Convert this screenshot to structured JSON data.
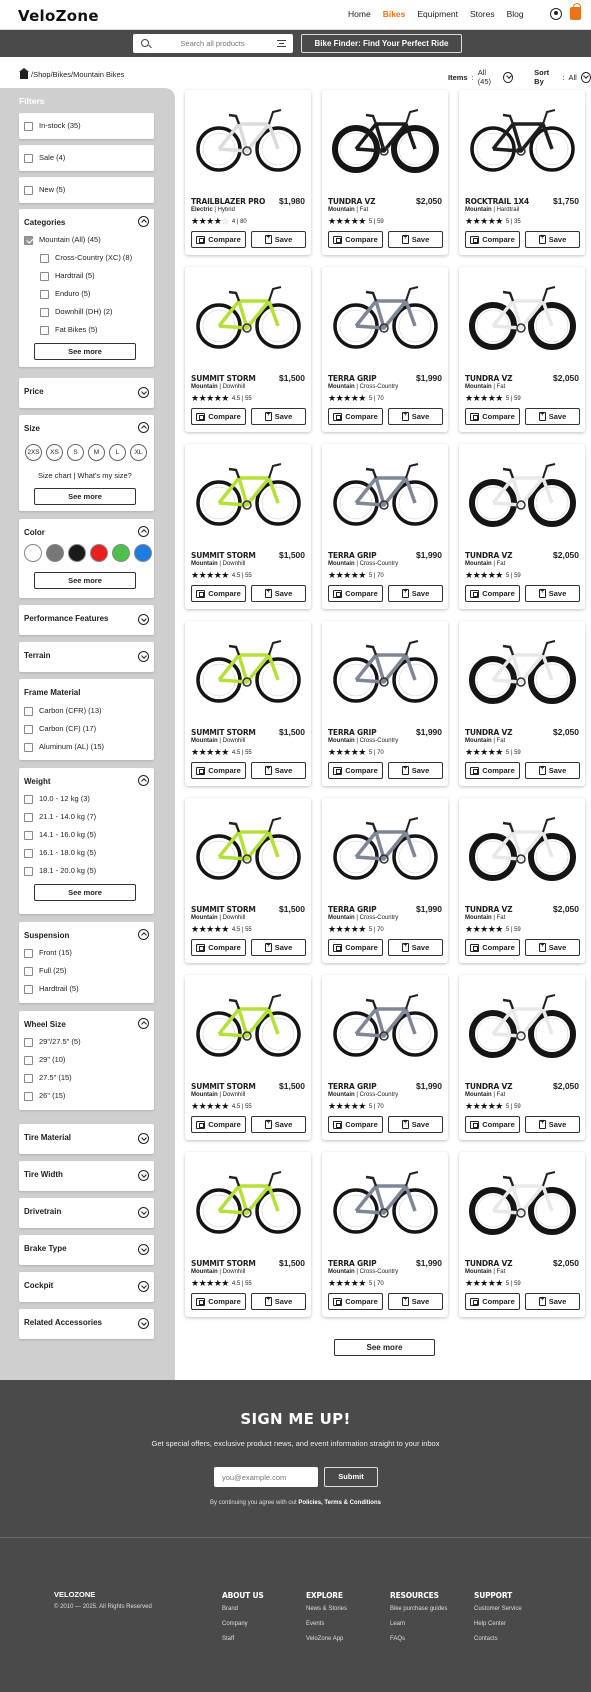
{
  "header": {
    "logo": "VeloZone",
    "nav": [
      "Home",
      "Bikes",
      "Equipment",
      "Stores",
      "Blog"
    ],
    "active_nav": "Bikes"
  },
  "search": {
    "placeholder": "Search all products",
    "finder_label": "Bike Finder: Find Your Perfect Ride"
  },
  "breadcrumb": "/Shop/Bikes/Mountain Bikes",
  "items_label": "Items",
  "items_value": "All (45)",
  "sort_label": "Sort By",
  "sort_value": "All",
  "filters": {
    "title": "Filters",
    "quick": [
      "In-stock (35)",
      "Sale (4)",
      "New (5)"
    ],
    "categories": {
      "title": "Categories",
      "parent": "Mountain (All) (45)",
      "items": [
        "Cross-Country (XC) (8)",
        "Hardtrail (5)",
        "Enduro (5)",
        "Downhill (DH) (2)",
        "Fat Bikes (5)"
      ],
      "see_more": "See more"
    },
    "price": "Price",
    "size": {
      "title": "Size",
      "options": [
        "2XS",
        "XS",
        "S",
        "M",
        "L",
        "XL"
      ],
      "chart": "Size chart",
      "what": "What's my size?",
      "see_more": "See more"
    },
    "color": {
      "title": "Color",
      "swatches": [
        "#ffffff",
        "#777777",
        "#1a1a1a",
        "#e82020",
        "#4cc24c",
        "#1e7be0"
      ],
      "see_more": "See more"
    },
    "performance": "Performance Features",
    "terrain": "Terrain",
    "frame": {
      "title": "Frame Material",
      "items": [
        "Carbon (CFR) (13)",
        "Carbon (CF) (17)",
        "Aluminum (AL) (15)"
      ]
    },
    "weight": {
      "title": "Weight",
      "items": [
        "10.0 - 12 kg  (3)",
        "21.1 - 14.0 kg (7)",
        "14.1 - 16.0 kg (5)",
        "16.1 - 18.0 kg (5)",
        "18.1 - 20.0 kg (5)"
      ],
      "see_more": "See more"
    },
    "suspension": {
      "title": "Suspension",
      "items": [
        "Front (15)",
        "Full (25)",
        "Hardtrail (5)"
      ]
    },
    "wheel": {
      "title": "Wheel Size",
      "items": [
        "29\"/27.5\" (5)",
        "29\" (10)",
        "27.5\" (15)",
        "26\" (15)"
      ]
    },
    "tire": "Tire Material",
    "tire_width": "Tire Width",
    "drivetrain": "Drivetrain",
    "brake": "Brake Type",
    "cockpit": "Cockpit",
    "accessories": "Related Accessories"
  },
  "products": [
    {
      "name": "TRAILBLAZER PRO",
      "price": "$1,980",
      "type": "Electric",
      "sub": "Hybrid",
      "rating": "4",
      "count": "80",
      "stars": 4,
      "img": "white-e"
    },
    {
      "name": "TUNDRA VZ",
      "price": "$2,050",
      "type": "Mountain",
      "sub": "Fat",
      "rating": "5",
      "count": "59",
      "stars": 5,
      "img": "black-fat"
    },
    {
      "name": "ROCKTRAIL 1X4",
      "price": "$1,750",
      "type": "Mountain",
      "sub": "Hardtrail",
      "rating": "5",
      "count": "35",
      "stars": 5,
      "img": "black"
    },
    {
      "name": "SUMMIT STORM",
      "price": "$1,500",
      "type": "Mountain",
      "sub": "Downhill",
      "rating": "4.5",
      "count": "55",
      "stars": 4.5,
      "img": "lime"
    },
    {
      "name": "TERRA GRIP",
      "price": "$1,990",
      "type": "Mountain",
      "sub": "Cross-Country",
      "rating": "5",
      "count": "70",
      "stars": 5,
      "img": "grey"
    },
    {
      "name": "TUNDRA VZ",
      "price": "$2,050",
      "type": "Mountain",
      "sub": "Fat",
      "rating": "5",
      "count": "59",
      "stars": 5,
      "img": "white-fat"
    },
    {
      "name": "SUMMIT STORM",
      "price": "$1,500",
      "type": "Mountain",
      "sub": "Downhill",
      "rating": "4.5",
      "count": "55",
      "stars": 4.5,
      "img": "lime"
    },
    {
      "name": "TERRA GRIP",
      "price": "$1,990",
      "type": "Mountain",
      "sub": "Cross-Country",
      "rating": "5",
      "count": "70",
      "stars": 5,
      "img": "grey"
    },
    {
      "name": "TUNDRA VZ",
      "price": "$2,050",
      "type": "Mountain",
      "sub": "Fat",
      "rating": "5",
      "count": "59",
      "stars": 5,
      "img": "white-fat"
    },
    {
      "name": "SUMMIT STORM",
      "price": "$1,500",
      "type": "Mountain",
      "sub": "Downhill",
      "rating": "4.5",
      "count": "55",
      "stars": 4.5,
      "img": "lime"
    },
    {
      "name": "TERRA GRIP",
      "price": "$1,990",
      "type": "Mountain",
      "sub": "Cross-Country",
      "rating": "5",
      "count": "70",
      "stars": 5,
      "img": "grey"
    },
    {
      "name": "TUNDRA VZ",
      "price": "$2,050",
      "type": "Mountain",
      "sub": "Fat",
      "rating": "5",
      "count": "59",
      "stars": 5,
      "img": "white-fat"
    },
    {
      "name": "SUMMIT STORM",
      "price": "$1,500",
      "type": "Mountain",
      "sub": "Downhill",
      "rating": "4.5",
      "count": "55",
      "stars": 4.5,
      "img": "lime"
    },
    {
      "name": "TERRA GRIP",
      "price": "$1,990",
      "type": "Mountain",
      "sub": "Cross-Country",
      "rating": "5",
      "count": "70",
      "stars": 5,
      "img": "grey"
    },
    {
      "name": "TUNDRA VZ",
      "price": "$2,050",
      "type": "Mountain",
      "sub": "Fat",
      "rating": "5",
      "count": "59",
      "stars": 5,
      "img": "white-fat"
    },
    {
      "name": "SUMMIT STORM",
      "price": "$1,500",
      "type": "Mountain",
      "sub": "Downhill",
      "rating": "4.5",
      "count": "55",
      "stars": 4.5,
      "img": "lime"
    },
    {
      "name": "TERRA GRIP",
      "price": "$1,990",
      "type": "Mountain",
      "sub": "Cross-Country",
      "rating": "5",
      "count": "70",
      "stars": 5,
      "img": "grey"
    },
    {
      "name": "TUNDRA VZ",
      "price": "$2,050",
      "type": "Mountain",
      "sub": "Fat",
      "rating": "5",
      "count": "59",
      "stars": 5,
      "img": "white-fat"
    },
    {
      "name": "SUMMIT STORM",
      "price": "$1,500",
      "type": "Mountain",
      "sub": "Downhill",
      "rating": "4.5",
      "count": "55",
      "stars": 4.5,
      "img": "lime"
    },
    {
      "name": "TERRA GRIP",
      "price": "$1,990",
      "type": "Mountain",
      "sub": "Cross-Country",
      "rating": "5",
      "count": "70",
      "stars": 5,
      "img": "grey"
    },
    {
      "name": "TUNDRA VZ",
      "price": "$2,050",
      "type": "Mountain",
      "sub": "Fat",
      "rating": "5",
      "count": "59",
      "stars": 5,
      "img": "white-fat"
    }
  ],
  "compare_label": "Compare",
  "save_label": "Save",
  "see_more": "See more",
  "newsletter": {
    "title": "SIGN ME UP!",
    "subtitle": "Get special offers, exclusive product news, and event information straight to your inbox",
    "placeholder": "you@example.com",
    "submit": "Submit",
    "terms_prefix": "By continuing you agree with out",
    "terms_link": "Policies, Terms & Conditions"
  },
  "footer": {
    "brand": "VELOZONE",
    "copyright": "© 2010 — 2025.  All Rights Reserved",
    "columns": [
      {
        "title": "ABOUT US",
        "links": [
          "Brand",
          "Company",
          "Staff"
        ]
      },
      {
        "title": "EXPLORE",
        "links": [
          "News & Stories",
          "Events",
          "VeloZone App"
        ]
      },
      {
        "title": "RESOURCES",
        "links": [
          "Bike purchase guides",
          "Learn",
          "FAQs"
        ]
      },
      {
        "title": "SUPPORT",
        "links": [
          "Customer Service",
          "Help Center",
          "Contacts"
        ]
      }
    ]
  },
  "colors": {
    "accent": "#e8751c",
    "dark": "#4a4a4a",
    "sidebar": "#cfcfcf"
  }
}
